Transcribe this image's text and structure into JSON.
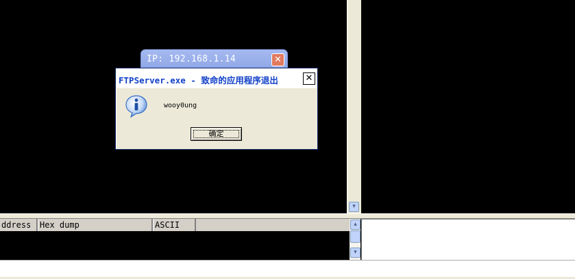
{
  "background_window": {
    "title": "IP: 192.168.1.14",
    "close_glyph": "✕"
  },
  "dialog": {
    "title": "FTPServer.exe - 致命的应用程序退出",
    "close_glyph": "✕",
    "message": "wooy0ung",
    "ok_label": "确定",
    "icon": "info-icon"
  },
  "dump": {
    "columns": [
      "ddress",
      "Hex dump",
      "ASCII"
    ]
  },
  "scroll": {
    "down_glyph": "▾",
    "up_glyph": "▴"
  },
  "colors": {
    "dialog_title_text": "#1140c8",
    "ip_window_title": "#8ea6e6",
    "close_button": "#e17a5f"
  }
}
